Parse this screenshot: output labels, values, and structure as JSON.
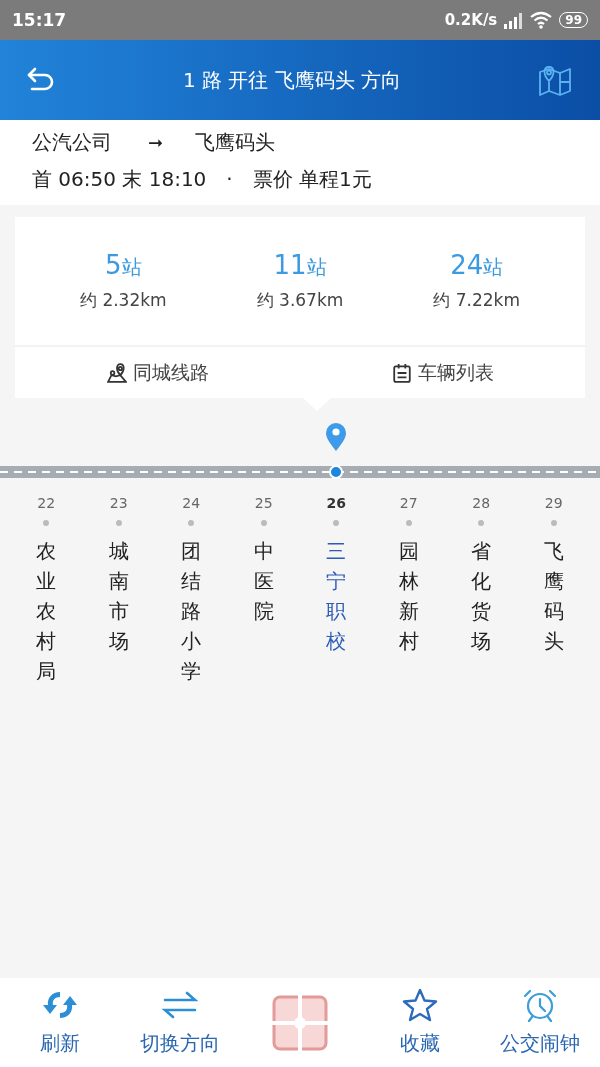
{
  "status_bar": {
    "time": "15:17",
    "speed": "0.2K/s",
    "battery": "99"
  },
  "header": {
    "title": "1 路 开往 飞鹰码头 方向"
  },
  "route": {
    "from": "公汽公司",
    "arrow": "➞",
    "to": "飞鹰码头",
    "first": "首 06:50 末 18:10",
    "separator": "·",
    "fare": "票价 单程1元"
  },
  "stats": [
    {
      "count": "5",
      "unit": "站",
      "distance": "约 2.32km"
    },
    {
      "count": "11",
      "unit": "站",
      "distance": "约 3.67km"
    },
    {
      "count": "24",
      "unit": "站",
      "distance": "约 7.22km"
    }
  ],
  "links": [
    {
      "kind": "map",
      "label": "同城线路"
    },
    {
      "kind": "calendar",
      "label": "车辆列表"
    }
  ],
  "stations": [
    {
      "number": "22",
      "name": "农业农村局",
      "selected": false
    },
    {
      "number": "23",
      "name": "城南市场",
      "selected": false
    },
    {
      "number": "24",
      "name": "团结路小学",
      "selected": false
    },
    {
      "number": "25",
      "name": "中医院",
      "selected": false
    },
    {
      "number": "26",
      "name": "三宁职校",
      "selected": true
    },
    {
      "number": "27",
      "name": "园林新村",
      "selected": false
    },
    {
      "number": "28",
      "name": "省化货场",
      "selected": false
    },
    {
      "number": "29",
      "name": "飞鹰码头",
      "selected": false
    }
  ],
  "tabbar": [
    {
      "kind": "refresh",
      "label": "刷新"
    },
    {
      "kind": "swap",
      "label": "切换方向"
    },
    {
      "kind": "scan"
    },
    {
      "kind": "star",
      "label": "收藏"
    },
    {
      "kind": "alarm",
      "label": "公交闹钟"
    }
  ]
}
